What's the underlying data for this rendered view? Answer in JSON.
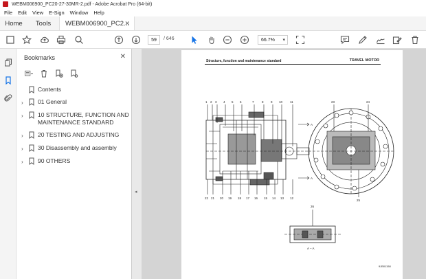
{
  "window": {
    "title": "WEBM006900_PC20-27-30MR-2.pdf - Adobe Acrobat Pro (64-bit)"
  },
  "menu": [
    "File",
    "Edit",
    "View",
    "E-Sign",
    "Window",
    "Help"
  ],
  "tabs": {
    "home": "Home",
    "tools": "Tools",
    "document": "WEBM006900_PC2..."
  },
  "toolbar": {
    "current_page": "59",
    "separator": "/",
    "page_count": "646",
    "zoom": "66.7%"
  },
  "bookmarks": {
    "header": "Bookmarks",
    "items": [
      {
        "label": "Contents",
        "expandable": false
      },
      {
        "label": "01 General",
        "expandable": true
      },
      {
        "label": "10 STRUCTURE, FUNCTION AND MAINTENANCE STANDARD",
        "expandable": true
      },
      {
        "label": "20 TESTING AND ADJUSTING",
        "expandable": true
      },
      {
        "label": "30 Disassembly and assembly",
        "expandable": true
      },
      {
        "label": "90 OTHERS",
        "expandable": true
      }
    ]
  },
  "pdf": {
    "header_left": "Structure, function and maintenance standard",
    "header_right": "TRAVEL MOTOR",
    "section_marks": [
      "A",
      "A"
    ],
    "callouts_top": [
      "1",
      "2",
      "3",
      "4",
      "5",
      "6",
      "7",
      "8",
      "9",
      "10",
      "11"
    ],
    "callouts_bottom": [
      "22",
      "21",
      "20",
      "19",
      "18",
      "17",
      "16",
      "15",
      "14",
      "13",
      "12"
    ],
    "callouts_right": [
      "23",
      "24",
      "25"
    ],
    "callout_small": "26",
    "section_caption": "A – A",
    "figure_id": "9JB01158"
  },
  "colors": {
    "accent": "#1473e6",
    "app_red": "#c5161d"
  }
}
